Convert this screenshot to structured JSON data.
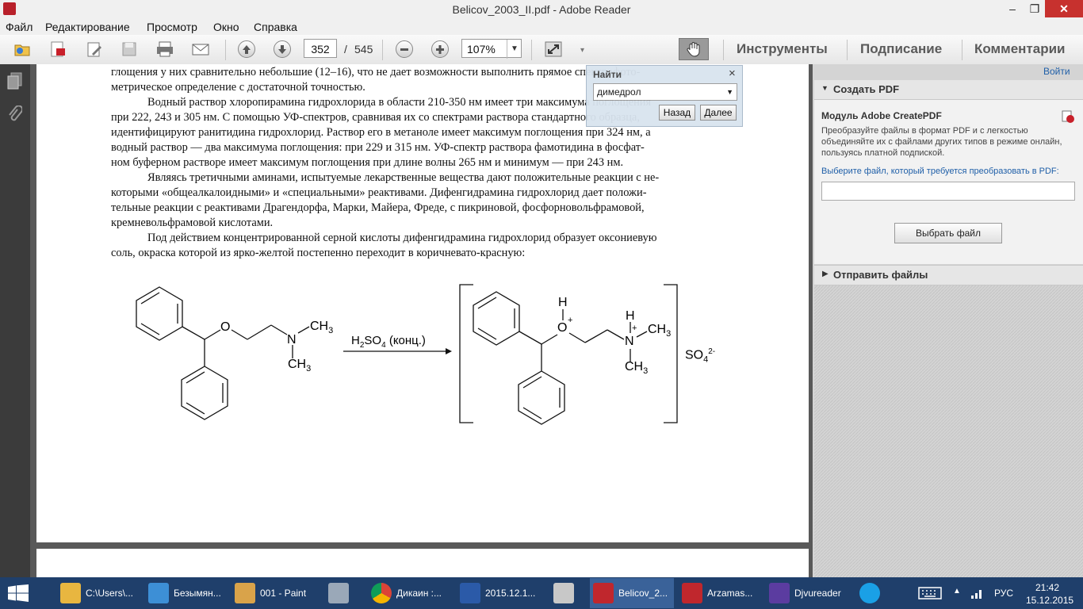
{
  "window": {
    "title": "Belicov_2003_II.pdf - Adobe Reader",
    "minimize": "–",
    "maximize": "❐",
    "close": "✕"
  },
  "menu": [
    "Файл",
    "Редактирование",
    "Просмотр",
    "Окно",
    "Справка"
  ],
  "toolbar": {
    "page_current": "352",
    "page_sep": "/",
    "page_total": "545",
    "zoom": "107%",
    "tools_label": "Инструменты",
    "sign_label": "Подписание",
    "comment_label": "Комментарии"
  },
  "find": {
    "title": "Найти",
    "close": "×",
    "query": "димедрол",
    "back_label": "Назад",
    "next_label": "Далее"
  },
  "document": {
    "paragraphs": [
      "глощения у них сравнительно небольшие (12–16), что не дает возможности выполнить прямое спектрофото-",
      "метрическое определение с достаточной точностью.",
      "Водный раствор хлоропирамина гидрохлорида в области 210-350 нм имеет три максимума поглощения",
      "при 222, 243 и 305 нм. С помощью УФ-спектров, сравнивая их со спектрами раствора стандартного образца,",
      "идентифицируют ранитидина гидрохлорид. Раствор его в метаноле имеет максимум поглощения при 324 нм, а",
      "водный раствор — два максимума поглощения: при 229 и 315 нм. УФ-спектр раствора фамотидина в фосфат-",
      "ном буферном растворе имеет максимум поглощения при длине волны 265 нм и минимум — при 243 нм.",
      "Являясь третичными аминами, испытуемые лекарственные вещества дают положительные реакции с не-",
      "которыми «общеалкалоидными» и «специальными» реактивами. Дифенгидрамина гидрохлорид дает положи-",
      "тельные реакции с реактивами Драгендорфа, Марки, Майера, Фреде, с пикриновой, фосфорновольфрамовой,",
      "кремневольфрамовой кислотами.",
      "Под действием концентрированной серной кислоты дифенгидрамина гидрохлорид образует оксониевую",
      "соль, окраска которой из ярко-желтой постепенно переходит в коричневато-красную:"
    ],
    "scheme": {
      "o_left": "O",
      "n_left": "N",
      "ch3": "CH",
      "sub3": "3",
      "h2so4_h": "H",
      "h2so4_2": "2",
      "h2so4_so": "SO",
      "h2so4_4": "4",
      "h2so4_cond": " (конц.)",
      "h": "H",
      "o_plus": "O",
      "n_plus": "N",
      "plus": "+",
      "so4": "SO",
      "so4_sub": "4",
      "so4_charge": "2-"
    }
  },
  "right_pane": {
    "signin": "Войти",
    "create_pdf": "Создать PDF",
    "module_title": "Модуль Adobe CreatePDF",
    "module_desc": "Преобразуйте файлы в формат PDF и с легкостью объединяйте их с файлами других типов в режиме онлайн, пользуясь платной подпиской.",
    "choose_prompt": "Выберите файл, который требуется преобразовать в PDF:",
    "choose_button": "Выбрать файл",
    "send_files": "Отправить файлы"
  },
  "taskbar": {
    "items": [
      {
        "label": "C:\\Users\\...",
        "color": "#e8b640"
      },
      {
        "label": "Безымян...",
        "color": "#3d8fd6"
      },
      {
        "label": "001 - Paint",
        "color": "#d9a34a"
      },
      {
        "label": "",
        "color": "#9aa8b8"
      },
      {
        "label": "Дикаин :...",
        "color": "#2f9e4f"
      },
      {
        "label": "2015.12.1...",
        "color": "#2b5aa8"
      },
      {
        "label": "",
        "color": "#c8c8c8"
      },
      {
        "label": "Belicov_2...",
        "color": "#c0272d"
      },
      {
        "label": "Arzamas...",
        "color": "#c0272d"
      },
      {
        "label": "Djvureader",
        "color": "#5b3ca0"
      },
      {
        "label": "",
        "color": "#1aa0e6"
      }
    ],
    "lang": "РУС",
    "time": "21:42",
    "date": "15.12.2015"
  }
}
